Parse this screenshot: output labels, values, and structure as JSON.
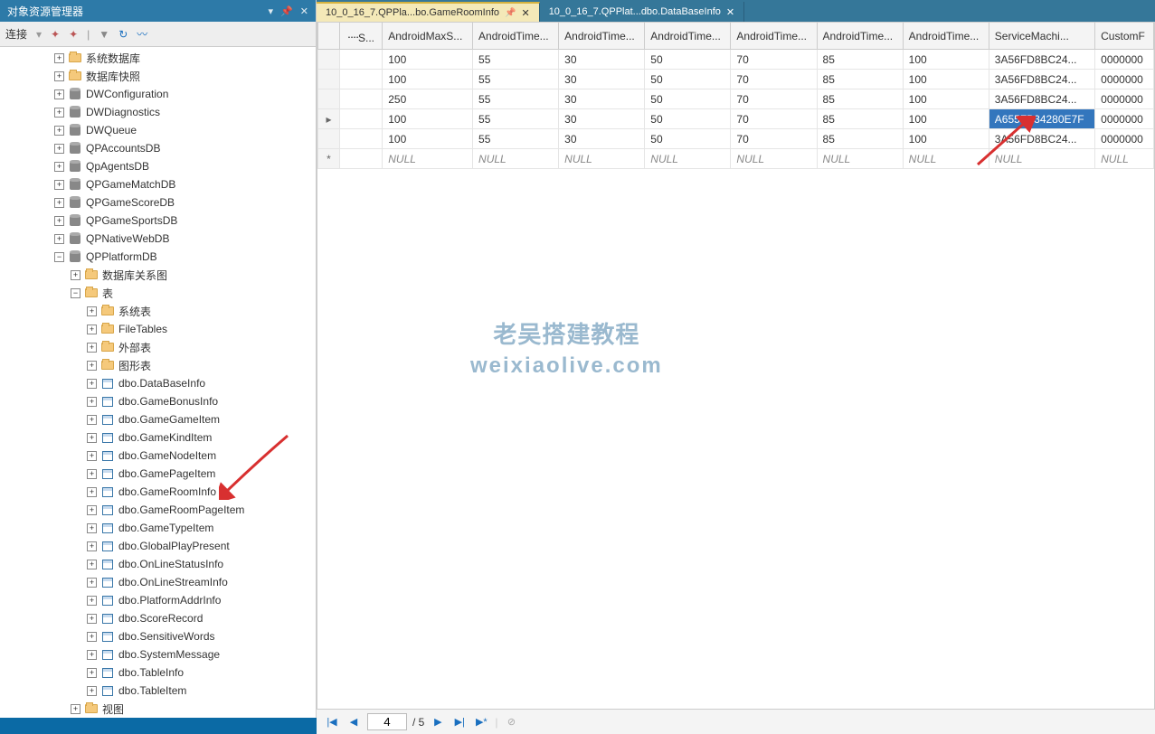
{
  "panel": {
    "title": "对象资源管理器",
    "toolbar_connect": "连接",
    "toolbar_sep": "▾"
  },
  "tree": [
    {
      "d": 3,
      "e": "+",
      "t": "folder",
      "l": "系统数据库"
    },
    {
      "d": 3,
      "e": "+",
      "t": "folder",
      "l": "数据库快照"
    },
    {
      "d": 3,
      "e": "+",
      "t": "db",
      "l": "DWConfiguration"
    },
    {
      "d": 3,
      "e": "+",
      "t": "db",
      "l": "DWDiagnostics"
    },
    {
      "d": 3,
      "e": "+",
      "t": "db",
      "l": "DWQueue"
    },
    {
      "d": 3,
      "e": "+",
      "t": "db",
      "l": "QPAccountsDB"
    },
    {
      "d": 3,
      "e": "+",
      "t": "db",
      "l": "QpAgentsDB"
    },
    {
      "d": 3,
      "e": "+",
      "t": "db",
      "l": "QPGameMatchDB"
    },
    {
      "d": 3,
      "e": "+",
      "t": "db",
      "l": "QPGameScoreDB"
    },
    {
      "d": 3,
      "e": "+",
      "t": "db",
      "l": "QPGameSportsDB"
    },
    {
      "d": 3,
      "e": "+",
      "t": "db",
      "l": "QPNativeWebDB"
    },
    {
      "d": 3,
      "e": "-",
      "t": "db",
      "l": "QPPlatformDB"
    },
    {
      "d": 4,
      "e": "+",
      "t": "folder",
      "l": "数据库关系图"
    },
    {
      "d": 4,
      "e": "-",
      "t": "folder",
      "l": "表"
    },
    {
      "d": 5,
      "e": "+",
      "t": "folder",
      "l": "系统表"
    },
    {
      "d": 5,
      "e": "+",
      "t": "folder",
      "l": "FileTables"
    },
    {
      "d": 5,
      "e": "+",
      "t": "folder",
      "l": "外部表"
    },
    {
      "d": 5,
      "e": "+",
      "t": "folder",
      "l": "图形表"
    },
    {
      "d": 5,
      "e": "+",
      "t": "table",
      "l": "dbo.DataBaseInfo"
    },
    {
      "d": 5,
      "e": "+",
      "t": "table",
      "l": "dbo.GameBonusInfo"
    },
    {
      "d": 5,
      "e": "+",
      "t": "table",
      "l": "dbo.GameGameItem"
    },
    {
      "d": 5,
      "e": "+",
      "t": "table",
      "l": "dbo.GameKindItem"
    },
    {
      "d": 5,
      "e": "+",
      "t": "table",
      "l": "dbo.GameNodeItem"
    },
    {
      "d": 5,
      "e": "+",
      "t": "table",
      "l": "dbo.GamePageItem"
    },
    {
      "d": 5,
      "e": "+",
      "t": "table",
      "l": "dbo.GameRoomInfo"
    },
    {
      "d": 5,
      "e": "+",
      "t": "table",
      "l": "dbo.GameRoomPageItem"
    },
    {
      "d": 5,
      "e": "+",
      "t": "table",
      "l": "dbo.GameTypeItem"
    },
    {
      "d": 5,
      "e": "+",
      "t": "table",
      "l": "dbo.GlobalPlayPresent"
    },
    {
      "d": 5,
      "e": "+",
      "t": "table",
      "l": "dbo.OnLineStatusInfo"
    },
    {
      "d": 5,
      "e": "+",
      "t": "table",
      "l": "dbo.OnLineStreamInfo"
    },
    {
      "d": 5,
      "e": "+",
      "t": "table",
      "l": "dbo.PlatformAddrInfo"
    },
    {
      "d": 5,
      "e": "+",
      "t": "table",
      "l": "dbo.ScoreRecord"
    },
    {
      "d": 5,
      "e": "+",
      "t": "table",
      "l": "dbo.SensitiveWords"
    },
    {
      "d": 5,
      "e": "+",
      "t": "table",
      "l": "dbo.SystemMessage"
    },
    {
      "d": 5,
      "e": "+",
      "t": "table",
      "l": "dbo.TableInfo"
    },
    {
      "d": 5,
      "e": "+",
      "t": "table",
      "l": "dbo.TableItem"
    },
    {
      "d": 4,
      "e": "+",
      "t": "folder",
      "l": "视图"
    }
  ],
  "tabs": [
    {
      "label": "10_0_16_7.QPPla...bo.GameRoomInfo",
      "active": true
    },
    {
      "label": "10_0_16_7.QPPlat...dbo.DataBaseInfo",
      "active": false
    }
  ],
  "grid": {
    "columns": [
      "᠁S...",
      "AndroidMaxS...",
      "AndroidTime...",
      "AndroidTime...",
      "AndroidTime...",
      "AndroidTime...",
      "AndroidTime...",
      "AndroidTime...",
      "ServiceMachi...",
      "CustomF"
    ],
    "rows": [
      {
        "hdr": "",
        "cells": [
          "",
          "100",
          "55",
          "30",
          "50",
          "70",
          "85",
          "100",
          "3A56FD8BC24...",
          "0000000"
        ]
      },
      {
        "hdr": "",
        "cells": [
          "",
          "100",
          "55",
          "30",
          "50",
          "70",
          "85",
          "100",
          "3A56FD8BC24...",
          "0000000"
        ]
      },
      {
        "hdr": "",
        "cells": [
          "",
          "250",
          "55",
          "30",
          "50",
          "70",
          "85",
          "100",
          "3A56FD8BC24...",
          "0000000"
        ]
      },
      {
        "hdr": "▸",
        "cells": [
          "",
          "100",
          "55",
          "30",
          "50",
          "70",
          "85",
          "100",
          "A655FB34280E7F",
          "0000000"
        ],
        "sel": 8
      },
      {
        "hdr": "",
        "cells": [
          "",
          "100",
          "55",
          "30",
          "50",
          "70",
          "85",
          "100",
          "3A56FD8BC24...",
          "0000000"
        ]
      },
      {
        "hdr": "*",
        "cells": [
          "",
          "NULL",
          "NULL",
          "NULL",
          "NULL",
          "NULL",
          "NULL",
          "NULL",
          "NULL",
          "NULL"
        ],
        "null": true
      }
    ]
  },
  "nav": {
    "current": "4",
    "of": "/ 5"
  },
  "watermark_l1": "老吴搭建教程",
  "watermark_l2": "weixiaolive.com"
}
